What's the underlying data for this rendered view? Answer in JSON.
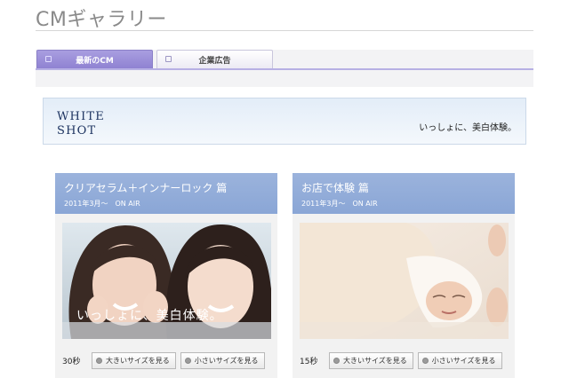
{
  "page": {
    "title": "CMギャラリー"
  },
  "tabs": [
    {
      "label": "最新のCM",
      "active": true
    },
    {
      "label": "企業広告",
      "active": false
    }
  ],
  "banner": {
    "logo_line1": "WHITE",
    "logo_line2": "SHOT",
    "tagline": "いっしょに、美白体験。"
  },
  "cards": [
    {
      "title": "クリアセラム＋インナーロック 篇",
      "date": "2011年3月〜　ON AIR",
      "caption": "いっしょに、美白体験。",
      "duration": "30秒",
      "large_button": "大きいサイズを見る",
      "small_button": "小さいサイズを見る"
    },
    {
      "title": "お店で体験 篇",
      "date": "2011年3月〜　ON AIR",
      "duration": "15秒",
      "large_button": "大きいサイズを見る",
      "small_button": "小さいサイズを見る"
    }
  ],
  "colors": {
    "accent": "#8f82d2",
    "card_header": "#8aa6d6"
  }
}
